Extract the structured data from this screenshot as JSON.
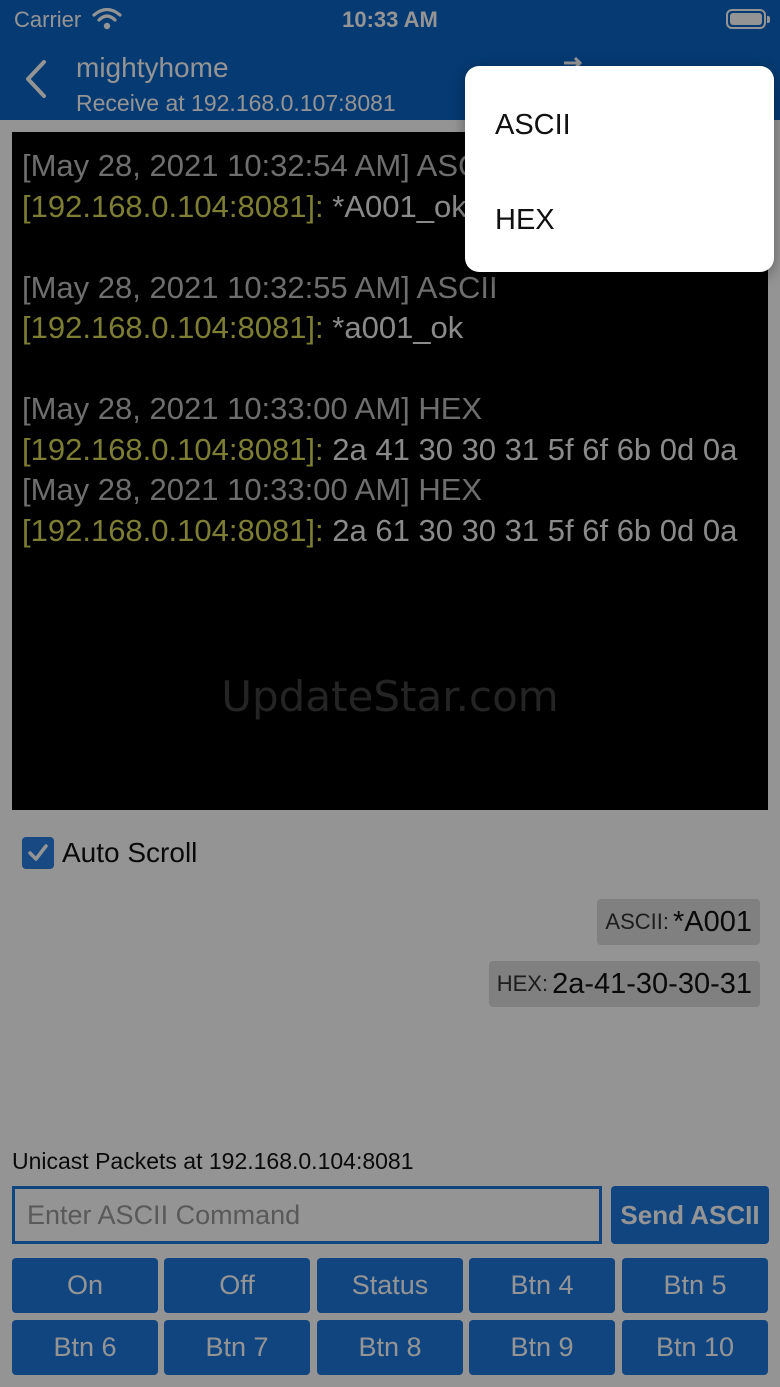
{
  "status_bar": {
    "carrier": "Carrier",
    "time": "10:33 AM"
  },
  "nav": {
    "title": "mightyhome",
    "subtitle": "Receive at 192.168.0.107:8081"
  },
  "console": {
    "entries": [
      {
        "timestamp": "[May 28, 2021 10:32:54 AM] ASCII",
        "address": "[192.168.0.104:8081]:",
        "payload": " *A001_ok"
      },
      {
        "timestamp": "[May 28, 2021 10:32:55 AM] ASCII",
        "address": "[192.168.0.104:8081]:",
        "payload": " *a001_ok"
      },
      {
        "timestamp": "[May 28, 2021 10:33:00 AM] HEX",
        "address": "[192.168.0.104:8081]:",
        "payload": " 2a 41 30 30 31 5f 6f 6b 0d 0a"
      },
      {
        "timestamp": "[May 28, 2021 10:33:00 AM] HEX",
        "address": "[192.168.0.104:8081]:",
        "payload": " 2a 61 30 30 31 5f 6f 6b 0d 0a"
      }
    ],
    "watermark": "UpdateStar.com"
  },
  "auto_scroll": {
    "label": "Auto Scroll",
    "checked": true
  },
  "shortcuts": {
    "ascii": {
      "prefix": "ASCII:",
      "value": "*A001"
    },
    "hex": {
      "prefix": "HEX:",
      "value": "2a-41-30-30-31"
    }
  },
  "unicast": {
    "label": "Unicast Packets at 192.168.0.104:8081"
  },
  "command": {
    "placeholder": "Enter ASCII Command",
    "value": "",
    "send_label": "Send ASCII"
  },
  "buttons": [
    "On",
    "Off",
    "Status",
    "Btn 4",
    "Btn 5",
    "Btn 6",
    "Btn 7",
    "Btn 8",
    "Btn 9",
    "Btn 10"
  ],
  "popup_menu": {
    "items": [
      "ASCII",
      "HEX"
    ]
  },
  "colors": {
    "primary": "#0a64c4",
    "button": "#1e78dc",
    "address": "#d7d75a",
    "timestamp": "#bdbdbd"
  }
}
